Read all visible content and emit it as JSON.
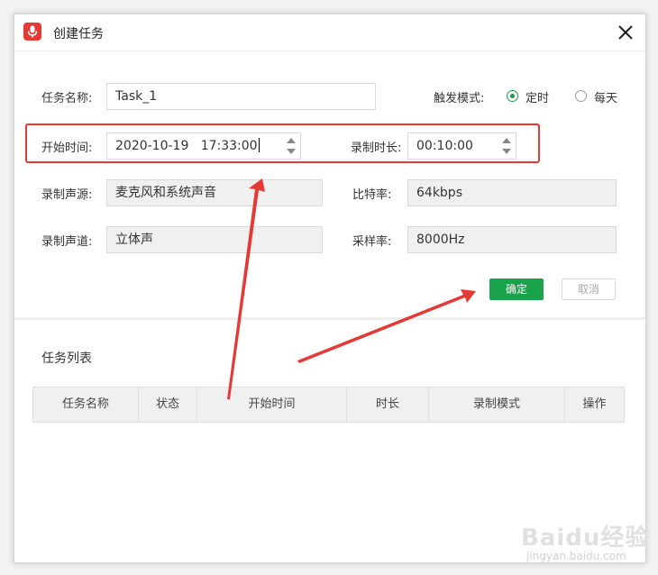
{
  "window": {
    "title": "创建任务",
    "icon": "microphone-icon",
    "close_icon": "close-icon"
  },
  "form": {
    "task_name": {
      "label": "任务名称:",
      "value": "Task_1"
    },
    "trigger_mode": {
      "label": "触发模式:",
      "options": [
        {
          "label": "定时",
          "checked": true
        },
        {
          "label": "每天",
          "checked": false
        }
      ]
    },
    "start_time": {
      "label": "开始时间:",
      "value": "2020-10-19   17:33:00"
    },
    "duration": {
      "label": "录制时长:",
      "value": "00:10:00"
    },
    "audio_source": {
      "label": "录制声源:",
      "value": "麦克风和系统声音"
    },
    "bitrate": {
      "label": "比特率:",
      "value": "64kbps"
    },
    "channel": {
      "label": "录制声道:",
      "value": "立体声"
    },
    "sample_rate": {
      "label": "采样率:",
      "value": "8000Hz"
    }
  },
  "buttons": {
    "ok": "确定",
    "cancel": "取消"
  },
  "task_list": {
    "title": "任务列表",
    "columns": [
      "任务名称",
      "状态",
      "开始时间",
      "时长",
      "录制模式",
      "操作"
    ]
  },
  "watermark": {
    "main": "Baidu经验",
    "sub": "jingyan.baidu.com"
  },
  "colors": {
    "accent": "#1aa34a",
    "highlight": "#e53935",
    "readonly_bg": "#f0f0f0"
  }
}
